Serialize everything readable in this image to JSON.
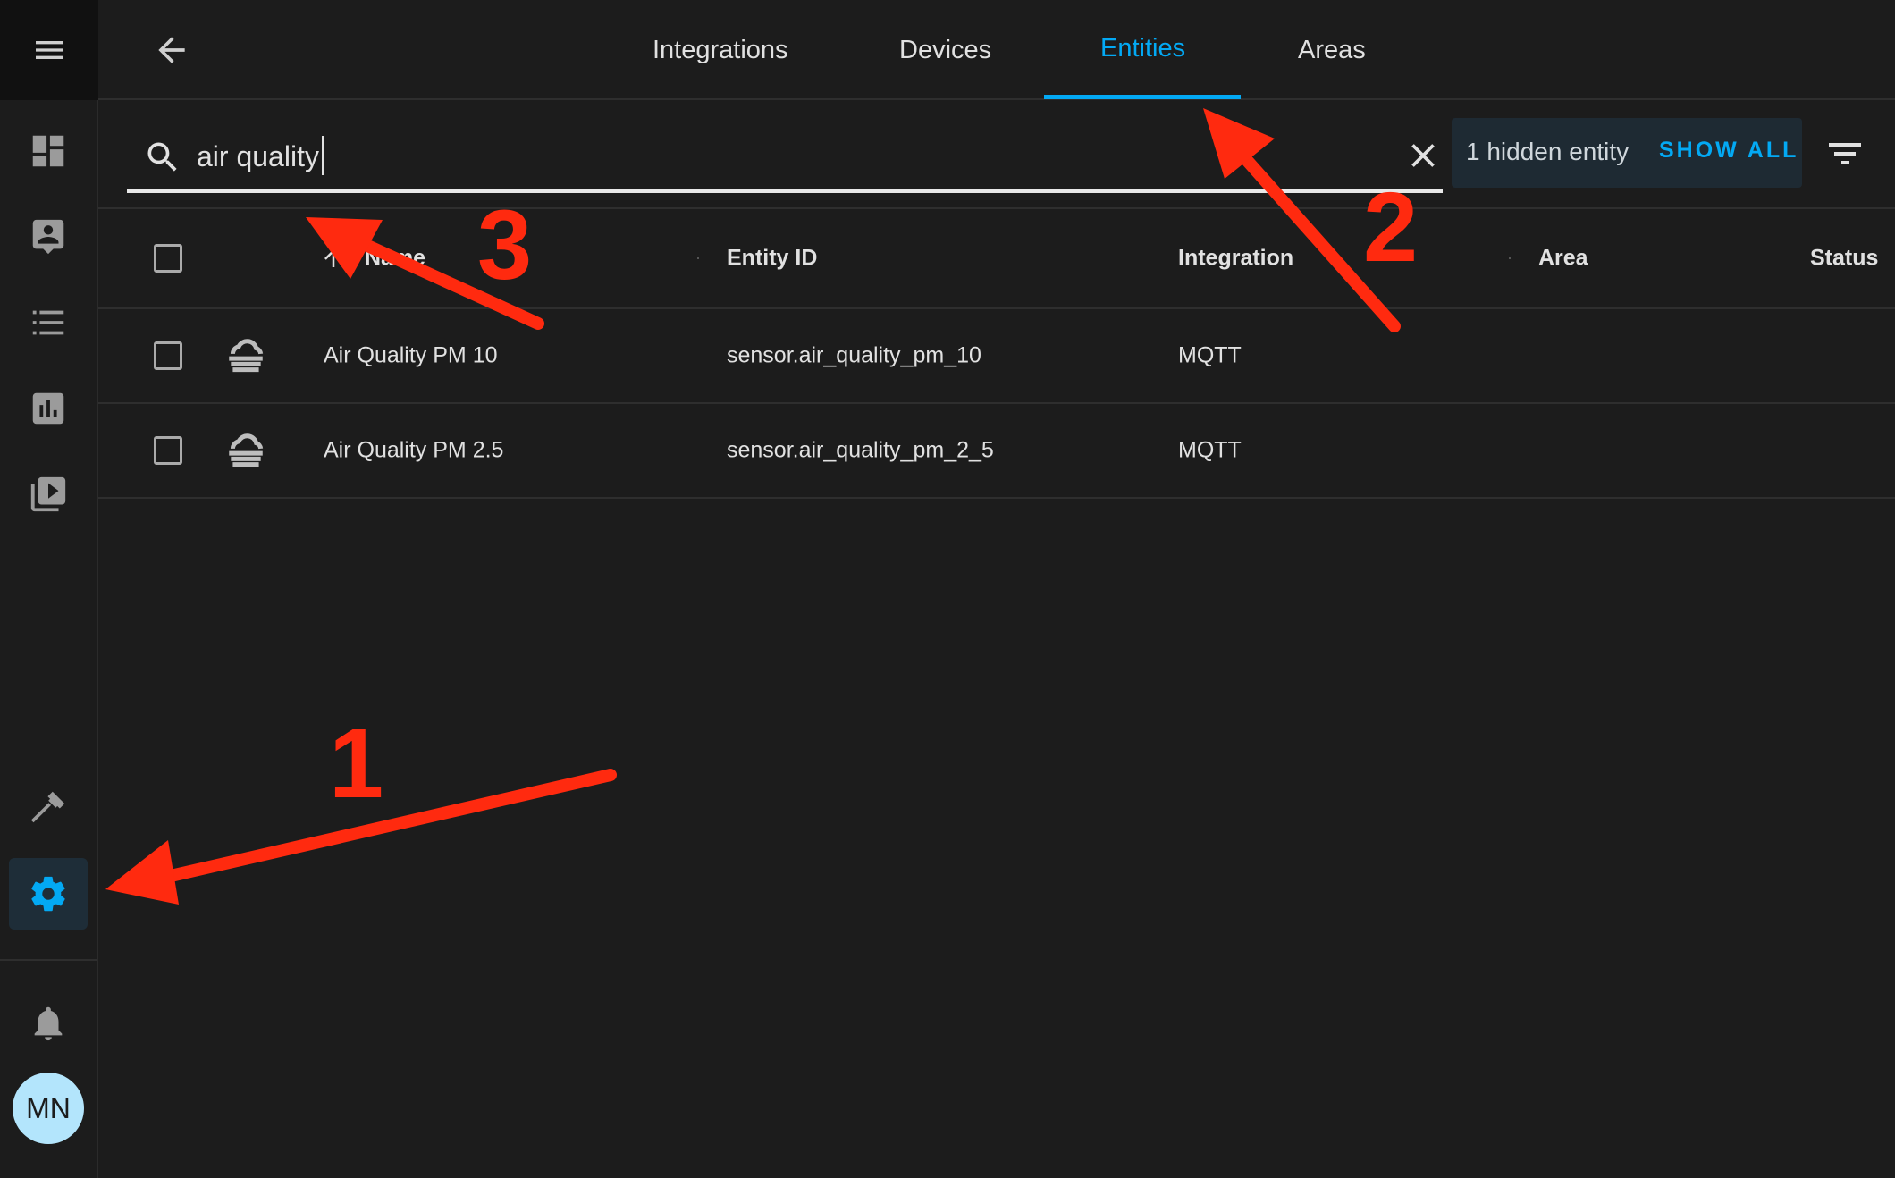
{
  "sidebar": {
    "items": [
      {
        "name": "dashboard-icon"
      },
      {
        "name": "map-person-icon"
      },
      {
        "name": "logbook-list-icon"
      },
      {
        "name": "history-chart-icon"
      },
      {
        "name": "media-play-icon"
      },
      {
        "name": "developer-tools-hammer-icon"
      },
      {
        "name": "settings-gear-icon",
        "active": true
      },
      {
        "name": "notifications-bell-icon"
      }
    ],
    "avatar_initials": "MN"
  },
  "tabs": [
    {
      "label": "Integrations"
    },
    {
      "label": "Devices"
    },
    {
      "label": "Entities",
      "active": true
    },
    {
      "label": "Areas"
    }
  ],
  "search": {
    "value": "air quality",
    "placeholder": ""
  },
  "hidden_notice": {
    "text": "1 hidden entity",
    "action": "SHOW ALL"
  },
  "table": {
    "headers": {
      "name": "Name",
      "entity_id": "Entity ID",
      "integration": "Integration",
      "area": "Area",
      "status": "Status"
    },
    "rows": [
      {
        "name": "Air Quality PM 10",
        "entity_id": "sensor.air_quality_pm_10",
        "integration": "MQTT",
        "icon": "weather-fog-icon"
      },
      {
        "name": "Air Quality PM 2.5",
        "entity_id": "sensor.air_quality_pm_2_5",
        "integration": "MQTT",
        "icon": "weather-fog-icon"
      }
    ]
  },
  "annotations": {
    "one": "1",
    "two": "2",
    "three": "3",
    "color": "#ff2a0f"
  },
  "colors": {
    "accent": "#03a9f4",
    "background": "#1c1c1c"
  }
}
